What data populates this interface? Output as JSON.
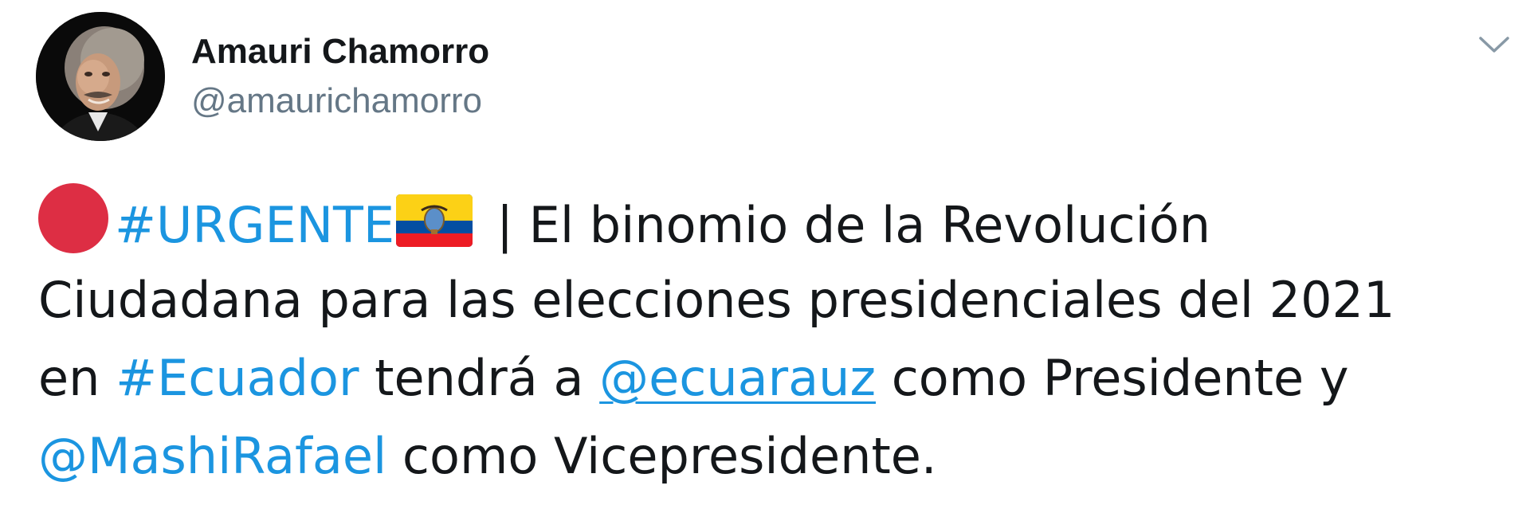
{
  "tweet": {
    "author": {
      "display_name": "Amauri Chamorro",
      "handle": "@amaurichamorro",
      "avatar_icon": "avatar-photo"
    },
    "menu_icon": "chevron-down-icon",
    "text": {
      "line1": {
        "emoji_dot": "red-circle-emoji",
        "hashtag": "#URGENTE",
        "emoji_flag": "ecuador-flag-emoji",
        "rest": "| El binomio de la Revolución"
      },
      "line2": "Ciudadana para las elecciones presidenciales del 2021",
      "line3": {
        "pre": "en ",
        "hashtag": "#Ecuador",
        "mid": " tendrá a ",
        "mention": "@ecuarauz",
        "post": " como Presidente y"
      },
      "line4": {
        "mention": "@MashiRafael",
        "post": " como Vicepresidente."
      }
    },
    "colors": {
      "link": "#1b95e0",
      "text": "#14171a",
      "secondary": "#657786",
      "red_dot": "#dd2e44",
      "flag_yellow": "#fcd116",
      "flag_blue": "#034ea2",
      "flag_red": "#ed1c24"
    }
  }
}
